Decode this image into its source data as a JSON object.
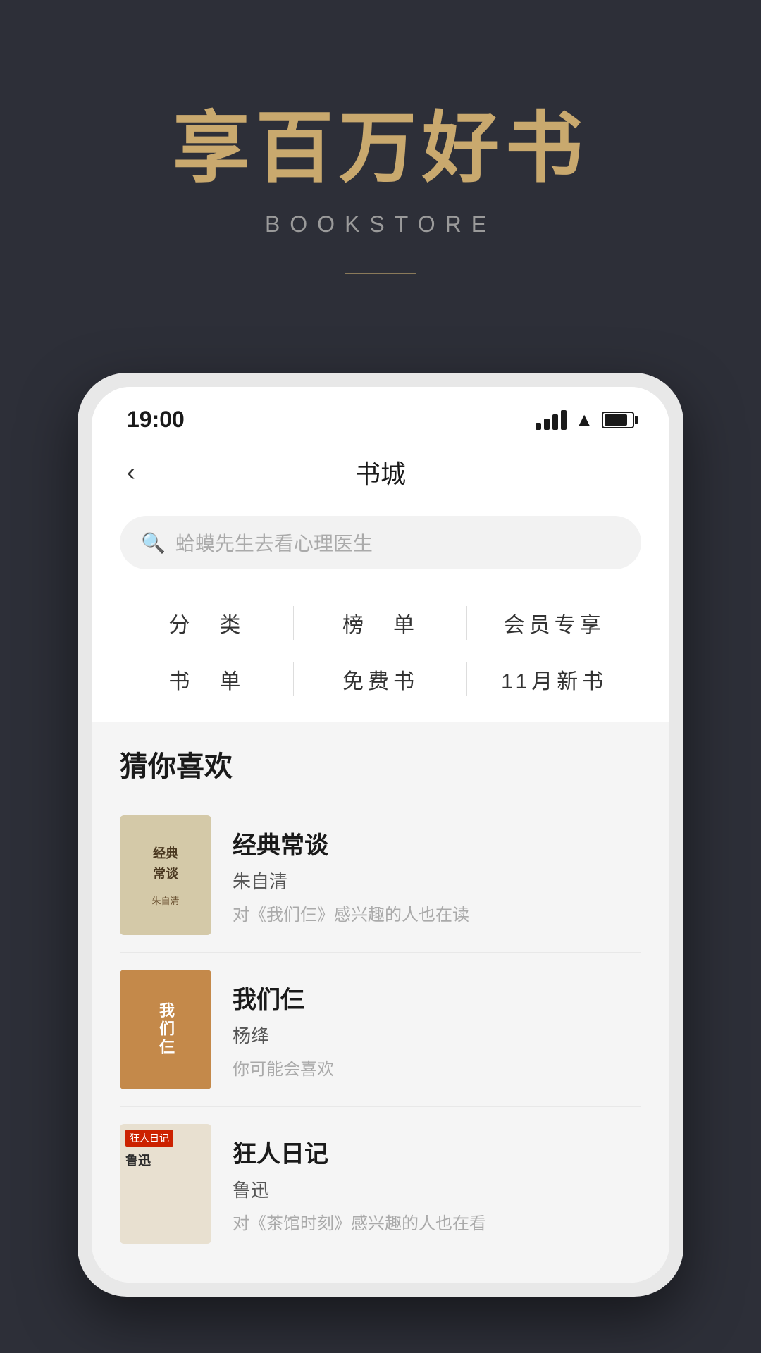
{
  "hero": {
    "title": "享百万好书",
    "subtitle": "BOOKSTORE",
    "divider": true
  },
  "phone": {
    "status_bar": {
      "time": "19:00",
      "signal_label": "signal",
      "wifi_label": "wifi",
      "battery_label": "battery"
    },
    "nav": {
      "back_icon": "‹",
      "title": "书城"
    },
    "search": {
      "icon": "🔍",
      "placeholder": "蛤蟆先生去看心理医生"
    },
    "categories": [
      {
        "label": "分　类"
      },
      {
        "label": "榜　单"
      },
      {
        "label": "会员专享"
      },
      {
        "label": "书　单"
      },
      {
        "label": "免费书"
      },
      {
        "label": "11月新书"
      }
    ],
    "recommendations": {
      "section_title": "猜你喜欢",
      "books": [
        {
          "title": "经典常谈",
          "author": "朱自清",
          "description": "对《我们仨》感兴趣的人也在读",
          "cover_type": "cover-1",
          "cover_text_line1": "经典",
          "cover_text_line2": "常谈"
        },
        {
          "title": "我们仨",
          "author": "杨绛",
          "description": "你可能会喜欢",
          "cover_type": "cover-2",
          "cover_text": "我们仨"
        },
        {
          "title": "狂人日记",
          "author": "鲁迅",
          "description": "对《茶馆时刻》感兴趣的人也在看",
          "cover_type": "cover-3",
          "cover_tag": "🔴",
          "cover_text": "狂人日记"
        }
      ]
    }
  }
}
